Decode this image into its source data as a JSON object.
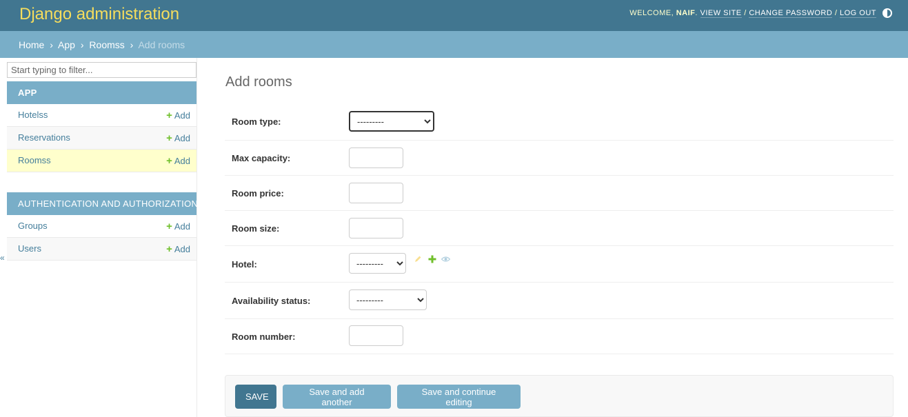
{
  "header": {
    "branding": "Django administration",
    "welcome": "Welcome,",
    "username": "NAIF",
    "period": ".",
    "view_site": "View site",
    "change_password": "Change password",
    "log_out": "Log out",
    "separator": "/"
  },
  "breadcrumbs": {
    "home": "Home",
    "app": "App",
    "model": "Roomss",
    "current": "Add rooms",
    "sep": "›"
  },
  "sidebar": {
    "filter_placeholder": "Start typing to filter...",
    "toggle": "«",
    "modules": [
      {
        "caption": "App",
        "rows": [
          {
            "label": "Hotelss",
            "add": "Add"
          },
          {
            "label": "Reservations",
            "add": "Add"
          },
          {
            "label": "Roomss",
            "add": "Add"
          }
        ]
      },
      {
        "caption": "Authentication and Authorization",
        "rows": [
          {
            "label": "Groups",
            "add": "Add"
          },
          {
            "label": "Users",
            "add": "Add"
          }
        ]
      }
    ]
  },
  "content": {
    "title": "Add rooms",
    "fields": {
      "room_type": {
        "label": "Room type:",
        "value": "---------"
      },
      "max_capacity": {
        "label": "Max capacity:",
        "value": ""
      },
      "room_price": {
        "label": "Room price:",
        "value": ""
      },
      "room_size": {
        "label": "Room size:",
        "value": ""
      },
      "hotel": {
        "label": "Hotel:",
        "value": "---------"
      },
      "availability_status": {
        "label": "Availability status:",
        "value": "---------"
      },
      "room_number": {
        "label": "Room number:",
        "value": ""
      }
    },
    "buttons": {
      "save": "SAVE",
      "save_add_another": "Save and add another",
      "save_continue": "Save and continue editing"
    }
  },
  "colors": {
    "header_bg": "#417690",
    "branding": "#f5dd5d",
    "breadcrumbs_bg": "#79aec8",
    "current_row": "#ffffcc",
    "add_plus": "#70bf2b",
    "link": "#447e9b"
  },
  "icons": {
    "plus": "+",
    "pencil": "pencil-icon",
    "eye": "eye-icon",
    "theme": "theme-toggle-icon"
  }
}
